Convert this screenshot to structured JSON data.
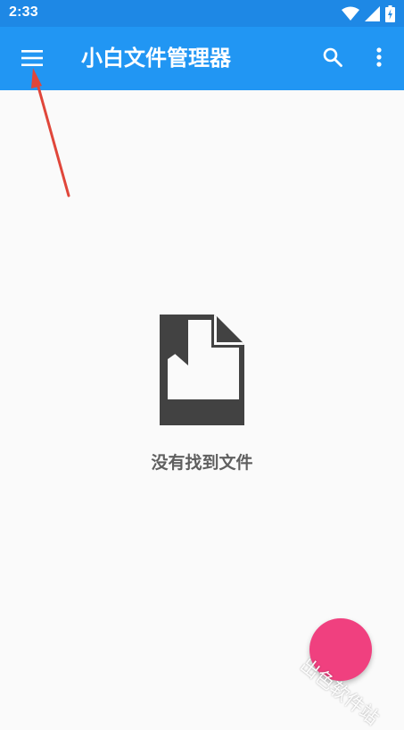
{
  "status_bar": {
    "time": "2:33",
    "icons": [
      "wifi-icon",
      "signal-icon",
      "battery-charging-icon"
    ]
  },
  "app_bar": {
    "title": "小白文件管理器",
    "menu_icon": "hamburger-menu-icon",
    "search_icon": "search-icon",
    "more_icon": "more-vert-icon"
  },
  "empty_state": {
    "icon": "empty-file-icon",
    "message": "没有找到文件"
  },
  "fab": {
    "color": "#f0407f"
  },
  "watermark": {
    "text": "出色软件站"
  },
  "colors": {
    "status_bar": "#1e88e5",
    "app_bar": "#2196f3",
    "background": "#fafafa",
    "annotation_arrow": "#e0463a",
    "icon_dark": "#424242"
  }
}
